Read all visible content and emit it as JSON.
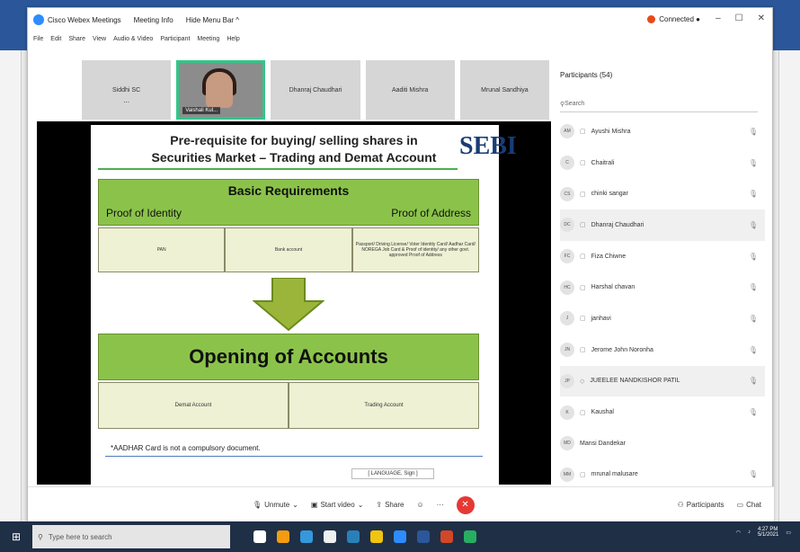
{
  "zoom": {
    "app_title": "Cisco Webex Meetings",
    "meeting_info": "Meeting Info",
    "hide_menu": "Hide Menu Bar ^",
    "connected": "Connected ●",
    "menu": [
      "File",
      "Edit",
      "Share",
      "View",
      "Audio & Video",
      "Participant",
      "Meeting",
      "Help"
    ]
  },
  "gallery": [
    {
      "name": "Siddhi SC",
      "sub": "...",
      "active": false
    },
    {
      "name": "Vaishali Kul...",
      "active": true
    },
    {
      "name": "Dhanraj Chaudhari",
      "active": false
    },
    {
      "name": "Aaditi Mishra",
      "active": false
    },
    {
      "name": "Mrunal Sandhiya",
      "active": false
    }
  ],
  "slide": {
    "title_line1": "Pre-requisite for buying/ selling shares in",
    "title_line2": "Securities Market – Trading and Demat Account",
    "basic_heading": "Basic Requirements",
    "poi": "Proof of Identity",
    "poa": "Proof of Address",
    "req_cells": [
      "PAN",
      "Bank account",
      "Passport/ Driving License/ Voter Identity Card/ Aadhar Card/ NOREGA Job Card & Proof of identity/ any other govt. approved Proof of Address"
    ],
    "opening_heading": "Opening of Accounts",
    "acct_cells": [
      "Demat Account",
      "Trading Account"
    ],
    "footnote": "*AADHAR Card is not a compulsory document.",
    "tag": "[ LANGUAGE, Sign ]"
  },
  "participants": {
    "heading": "Participants (54)",
    "search_placeholder": "Search",
    "list": [
      {
        "initials": "AM",
        "name": "Ayushi Mishra"
      },
      {
        "initials": "C",
        "name": "Chaitrali"
      },
      {
        "initials": "CS",
        "name": "chinki sangar"
      },
      {
        "initials": "DC",
        "name": "Dhanraj Chaudhari"
      },
      {
        "initials": "FC",
        "name": "Fiza Chiwne"
      },
      {
        "initials": "HC",
        "name": "Harshal chavan"
      },
      {
        "initials": "J",
        "name": "janhavi"
      },
      {
        "initials": "JN",
        "name": "Jerome John Noronha"
      },
      {
        "initials": "JP",
        "name": "JUEELEE NANDKISHOR PATIL"
      },
      {
        "initials": "K",
        "name": "Kaushal"
      },
      {
        "initials": "MD",
        "name": "Mansi Dandekar"
      },
      {
        "initials": "MM",
        "name": "mrunal malusare"
      }
    ]
  },
  "toolbar": {
    "unmute": "Unmute",
    "start_video": "Start video",
    "share": "Share",
    "participants": "Participants",
    "chat": "Chat"
  },
  "taskbar": {
    "search_placeholder": "Type here to search",
    "time": "4:27 PM",
    "date": "5/1/2021"
  }
}
